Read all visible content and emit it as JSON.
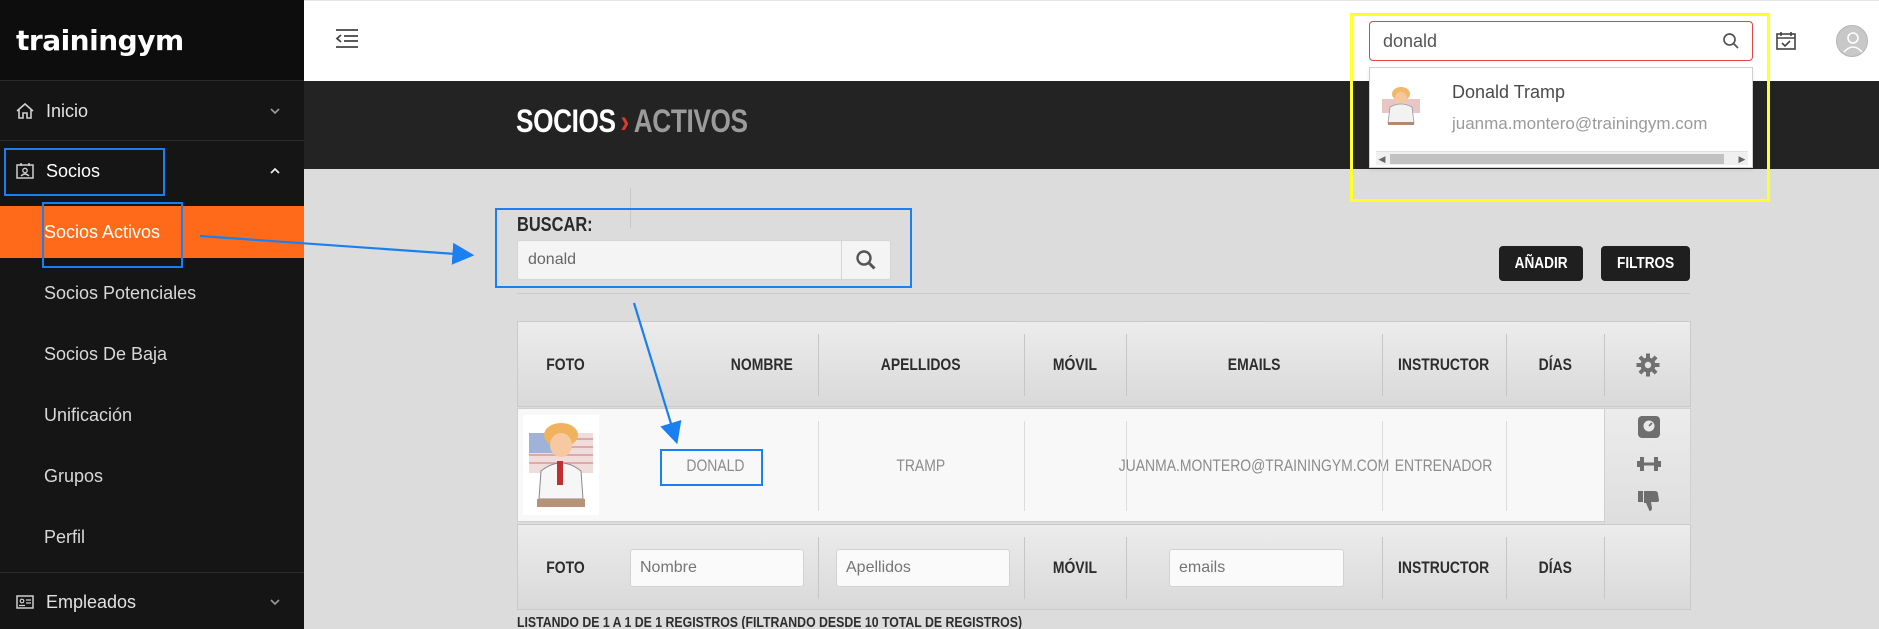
{
  "app": {
    "logo": "trainingym"
  },
  "sidebar": {
    "items": [
      {
        "label": "Inicio"
      },
      {
        "label": "Socios"
      },
      {
        "label": "Empleados"
      }
    ],
    "sub_items": [
      {
        "label": "Socios Activos",
        "active": true
      },
      {
        "label": "Socios Potenciales"
      },
      {
        "label": "Socios De Baja"
      },
      {
        "label": "Unificación"
      },
      {
        "label": "Grupos"
      },
      {
        "label": "Perfil"
      }
    ]
  },
  "topbar": {
    "search_value": "donald",
    "autocomplete": {
      "name": "Donald Tramp",
      "email": "juanma.montero@trainingym.com"
    }
  },
  "header": {
    "section": "SOCIOS",
    "separator": "›",
    "subsection": "ACTIVOS"
  },
  "search": {
    "label": "BUSCAR:",
    "value": "donald"
  },
  "buttons": {
    "add": "AÑADIR",
    "filters": "FILTROS"
  },
  "table": {
    "columns": [
      "FOTO",
      "NOMBRE",
      "APELLIDOS",
      "MÓVIL",
      "EMAILS",
      "INSTRUCTOR",
      "DÍAS"
    ],
    "rows": [
      {
        "nombre": "DONALD",
        "apellidos": "TRAMP",
        "movil": "",
        "email": "JUANMA.MONTERO@TRAININGYM.COM",
        "instructor": "ENTRENADOR",
        "dias": ""
      }
    ],
    "filters": {
      "foto": "FOTO",
      "nombre_placeholder": "Nombre",
      "apellidos_placeholder": "Apellidos",
      "movil": "MÓVIL",
      "emails_placeholder": "emails",
      "instructor": "INSTRUCTOR",
      "dias": "DÍAS"
    },
    "listing": "LISTANDO DE 1 A 1 DE 1 REGISTROS (FILTRANDO DESDE 10 TOTAL DE REGISTROS)"
  },
  "colors": {
    "accent": "#ff6a1a",
    "sidebar": "#151515",
    "annotation_blue": "#1a7ff0",
    "annotation_yellow": "#ffff2a",
    "search_border": "#e2463c"
  }
}
